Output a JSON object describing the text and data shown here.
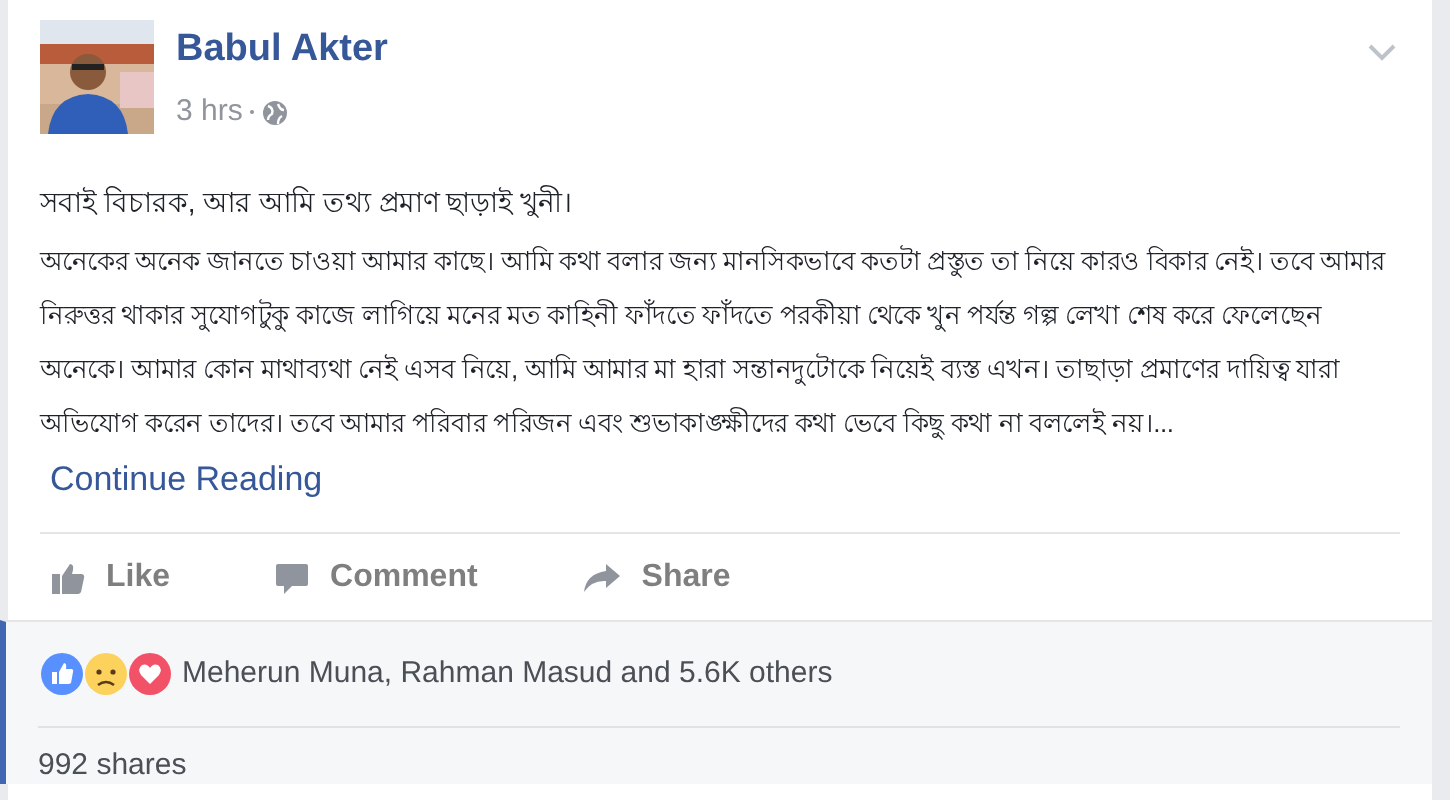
{
  "post": {
    "author": "Babul Akter",
    "time": "3 hrs",
    "headline": "সবাই বিচারক, আর আমি তথ্য প্রমাণ ছাড়াই খুনী।",
    "body": "অনেকের অনেক জানতে চাওয়া আমার কাছে। আমি কথা বলার জন্য মানসিকভাবে কতটা প্রস্তুত তা নিয়ে কারও বিকার নেই। তবে আমার নিরুত্তর থাকার সুযোগটুকু কাজে লাগিয়ে মনের মত কাহিনী ফাঁদতে ফাঁদতে পরকীয়া থেকে খুন পর্যন্ত গল্প লেখা শেষ করে ফেলেছেন অনেকে। আমার কোন মাথাব্যথা নেই এসব নিয়ে, আমি আমার মা হারা সন্তানদুটোকে নিয়েই ব্যস্ত এখন। তাছাড়া প্রমাণের দায়িত্ব যারা অভিযোগ করেন তাদের। তবে আমার পরিবার পরিজন এবং শুভাকাঙ্ক্ষীদের কথা ভেবে কিছু কথা না বললেই নয়।...",
    "continue_link": "Continue Reading"
  },
  "actions": [
    {
      "kind": "like",
      "label": "Like"
    },
    {
      "kind": "comment",
      "label": "Comment"
    },
    {
      "kind": "share",
      "label": "Share"
    }
  ],
  "reactions": {
    "text": "Meherun Muna, Rahman Masud and 5.6K others"
  },
  "shares": "992 shares"
}
